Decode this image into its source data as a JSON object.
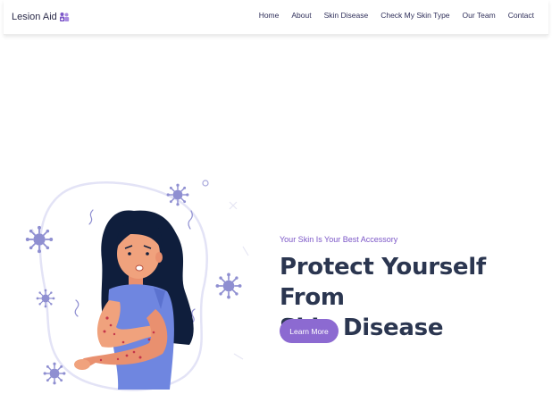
{
  "brand": {
    "name": "Lesion Aid",
    "icon": "medical-team-icon",
    "icon_color": "#7b56c7"
  },
  "nav": {
    "items": [
      {
        "label": "Home"
      },
      {
        "label": "About"
      },
      {
        "label": "Skin Disease"
      },
      {
        "label": "Check My Skin Type"
      },
      {
        "label": "Our Team"
      },
      {
        "label": "Contact"
      }
    ]
  },
  "hero": {
    "tagline": "Your Skin Is Your Best Accessory",
    "headline_line1": "Protect Yourself From",
    "headline_line2": "Skin Disease",
    "cta_label": "Learn More",
    "illustration": "woman-with-skin-rash-illustration"
  },
  "colors": {
    "accent": "#8c6ad1",
    "tagline": "#7b56c7",
    "headline": "#2b3650",
    "nav_text": "#2f2f5a",
    "virus": "#8f8fd1"
  }
}
